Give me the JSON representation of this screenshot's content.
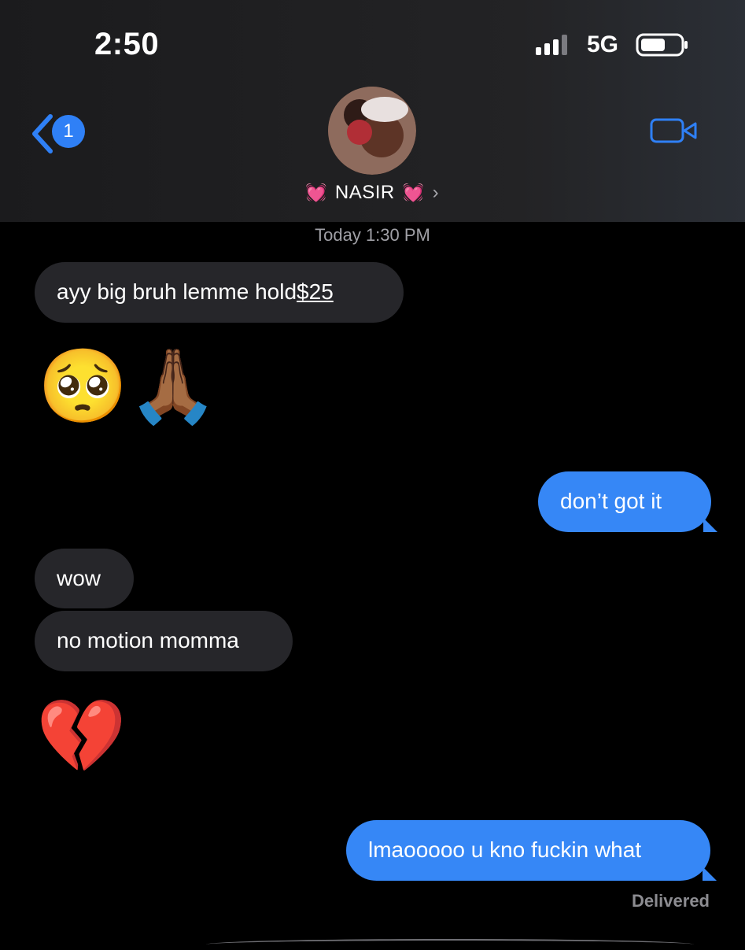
{
  "status_bar": {
    "time": "2:50",
    "network": "5G"
  },
  "header": {
    "back_badge": "1",
    "contact_name": "NASIR",
    "contact_emoji": "💓",
    "chevron": "›",
    "video_icon": "video-camera-icon"
  },
  "conversation": {
    "timestamp": "Today 1:30 PM",
    "messages": [
      {
        "type": "incoming",
        "text": "ayy big bruh lemme hold ",
        "link": "$25"
      },
      {
        "type": "incoming_emoji",
        "text": "🥺🙏🏾"
      },
      {
        "type": "outgoing",
        "text": "don’t got it"
      },
      {
        "type": "incoming",
        "text": "wow"
      },
      {
        "type": "incoming",
        "text": "no motion momma"
      },
      {
        "type": "incoming_emoji",
        "text": "💔"
      },
      {
        "type": "outgoing",
        "text": "lmaooooo u kno fuckin what"
      }
    ],
    "delivered": "Delivered"
  },
  "colors": {
    "outgoing": "#3687f6",
    "incoming": "#26262a",
    "accent": "#2f80f6",
    "background": "#000000"
  }
}
